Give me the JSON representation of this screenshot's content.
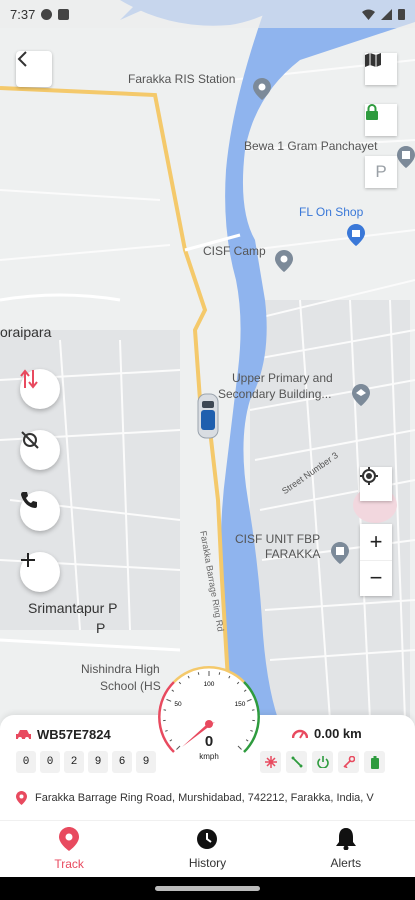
{
  "status_bar": {
    "time": "7:37"
  },
  "map": {
    "labels": {
      "farakka_ris": "Farakka RIS Station",
      "bewa": "Bewa 1 Gram Panchayet",
      "fl_on_shop": "FL On Shop",
      "cisf_camp": "CISF Camp",
      "oraipara": "oraipara",
      "upper_primary_1": "Upper Primary and",
      "upper_primary_2": "Secondary Building...",
      "street_number": "Street Number 3",
      "cisf_unit_1": "CISF UNIT FBP",
      "cisf_unit_2": "FARAKKA",
      "srimantapur_1": "Srimantapur P",
      "srimantapur_2": "P",
      "nishindra_1": "Nishindra High",
      "nishindra_2": "School (HS",
      "road_name": "Farakka Barrage Ring Rd"
    },
    "parking_label": "P",
    "zoom_in": "+",
    "zoom_out": "−"
  },
  "speedometer": {
    "speed": "0",
    "unit": "kmph",
    "ticks": [
      "50",
      "100",
      "150"
    ],
    "max_value": 200
  },
  "vehicle": {
    "plate": "WB57E7824",
    "odometer": [
      "0",
      "0",
      "2",
      "9",
      "6",
      "9"
    ],
    "distance": "0.00 km",
    "address": "Farakka Barrage Ring Road, Murshidabad, 742212, Farakka, India, V"
  },
  "nav": {
    "track": "Track",
    "history": "History",
    "alerts": "Alerts"
  },
  "colors": {
    "accent": "#e84a5f",
    "river": "#8fb4ee",
    "road": "#f4c96b",
    "green": "#2e9b3e"
  }
}
